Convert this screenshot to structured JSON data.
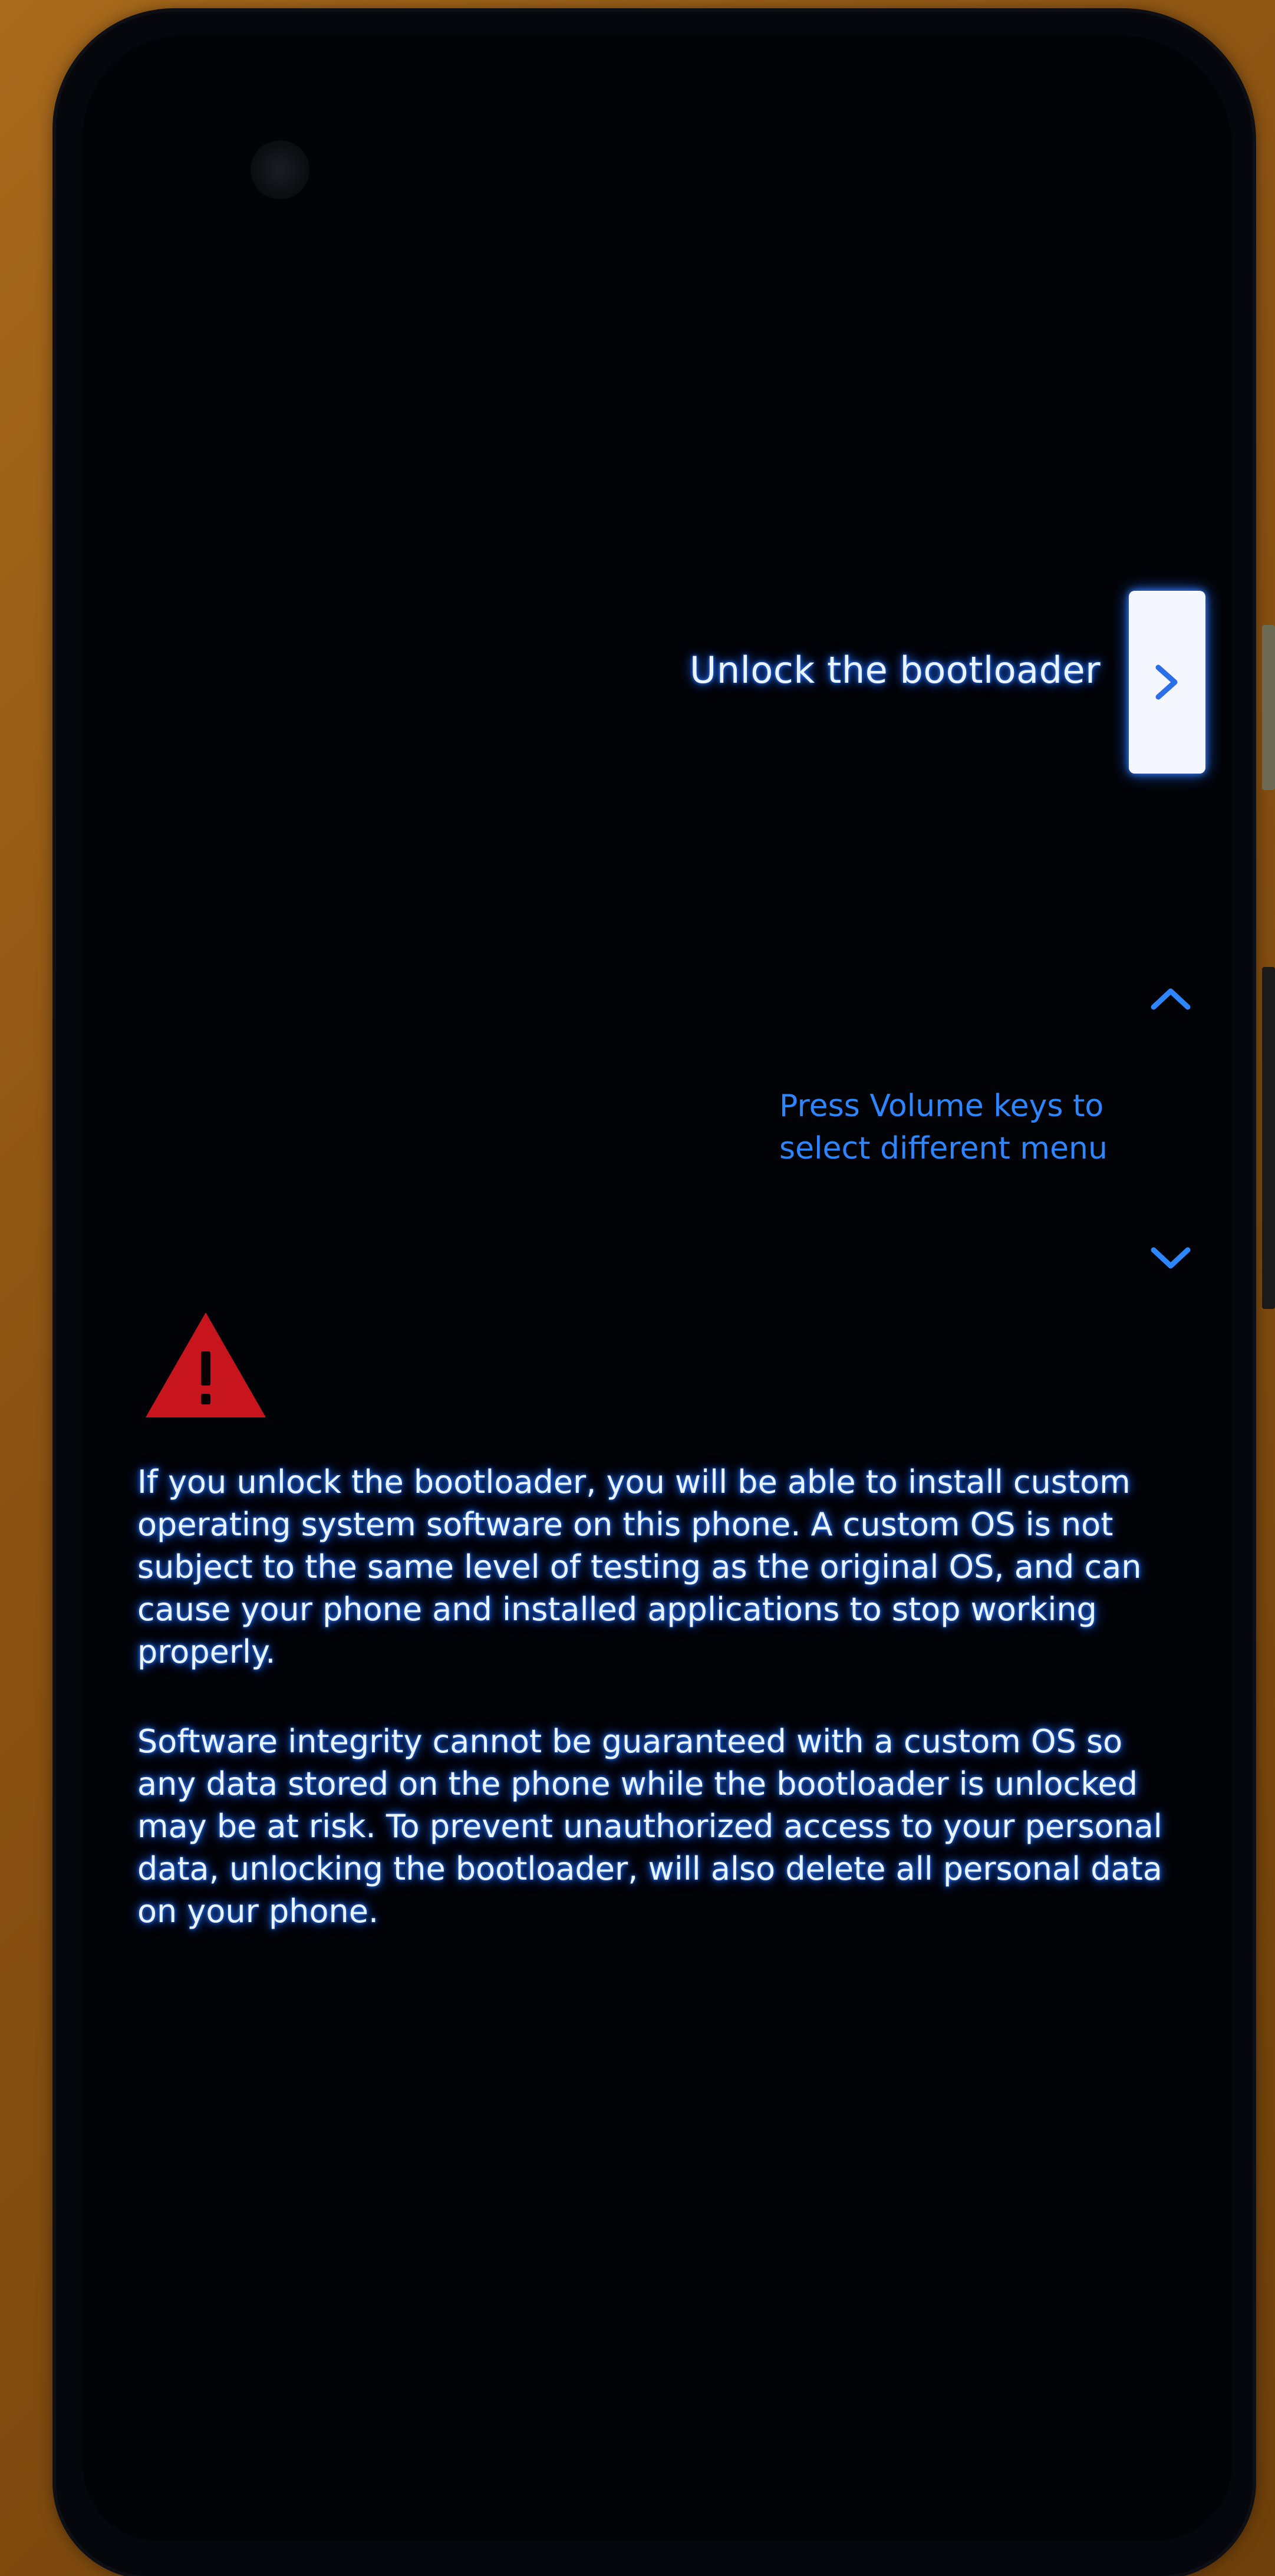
{
  "menu": {
    "current_option": "Unlock the bootloader",
    "select_icon": "chevron-right-icon"
  },
  "navigation": {
    "up_icon": "chevron-up-icon",
    "down_icon": "chevron-down-icon",
    "hint_line1": "Press Volume keys to",
    "hint_line2": "select different menu"
  },
  "warning": {
    "icon": "warning-triangle-icon",
    "paragraph1": "If you unlock the bootloader, you will be able to install custom operating system software on this phone. A custom OS is not subject to the same level of testing as the original OS, and can cause your phone and installed applications to stop working properly.",
    "paragraph2": "Software integrity cannot be guaranteed with a custom OS so any data stored on the phone while the bootloader is unlocked may be at risk. To prevent unauthorized access to your personal data, unlocking the bootloader, will also delete all personal data on your phone."
  },
  "colors": {
    "background": "#020306",
    "text": "#eaf4ff",
    "text_glow": "#2f7dff",
    "hint": "#2e86ff",
    "warning": "#c8141c",
    "button": "#f4f7ff"
  }
}
